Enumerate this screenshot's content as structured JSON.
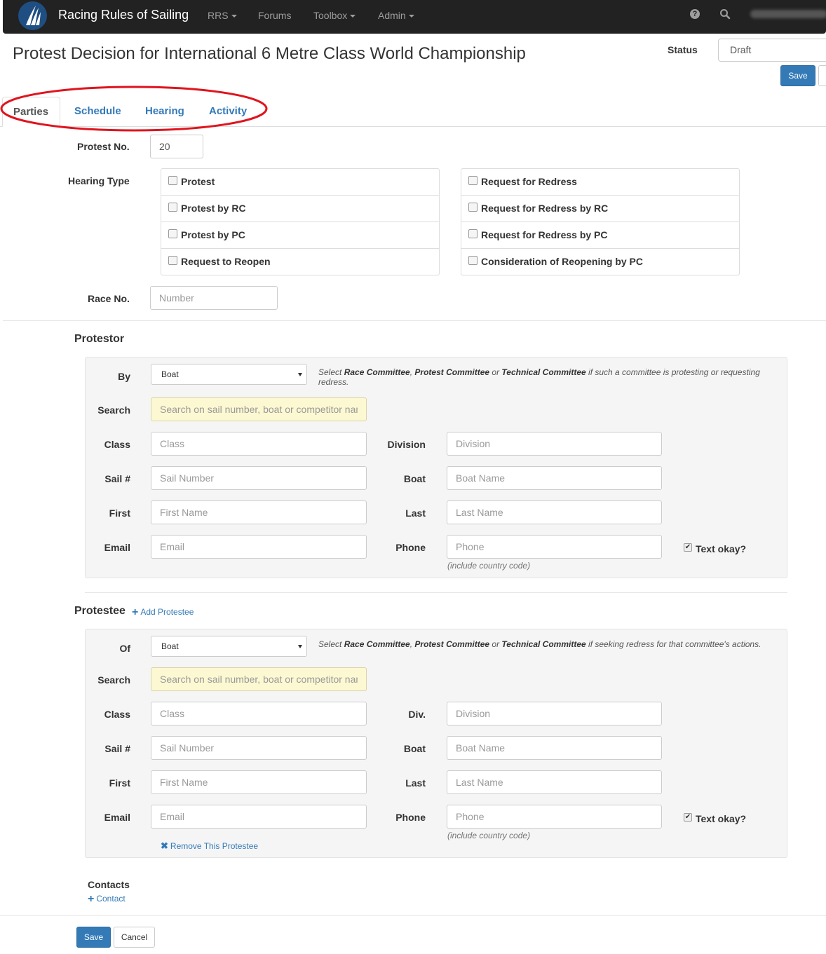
{
  "navbar": {
    "brand": "Racing Rules of Sailing",
    "menu": [
      "RRS",
      "Forums",
      "Toolbox",
      "Admin"
    ],
    "help_icon": "question-circle-icon",
    "search_icon": "search-icon"
  },
  "header": {
    "title": "Protest Decision for International 6 Metre Class World Championship",
    "status_label": "Status",
    "status_value": "Draft",
    "save_label": "Save"
  },
  "tabs": [
    "Parties",
    "Schedule",
    "Hearing",
    "Activity"
  ],
  "form": {
    "protest_no_label": "Protest No.",
    "protest_no_value": "20",
    "hearing_type_label": "Hearing Type",
    "hearing_types_left": [
      "Protest",
      "Protest by RC",
      "Protest by PC",
      "Request to Reopen"
    ],
    "hearing_types_right": [
      "Request for Redress",
      "Request for Redress by RC",
      "Request for Redress by PC",
      "Consideration of Reopening by PC"
    ],
    "race_no_label": "Race No.",
    "race_no_placeholder": "Number"
  },
  "protestor": {
    "title": "Protestor",
    "by_label": "By",
    "by_value": "Boat",
    "hint_pre": "Select ",
    "hint_rc": "Race Committee",
    "hint_sep1": ", ",
    "hint_pc": "Protest Committee",
    "hint_or": " or ",
    "hint_tc": "Technical Committee",
    "hint_post": " if such a committee is protesting or requesting redress.",
    "search_label": "Search",
    "search_placeholder": "Search on sail number, boat or competitor name",
    "class_label": "Class",
    "class_placeholder": "Class",
    "division_label": "Division",
    "division_placeholder": "Division",
    "sail_label": "Sail #",
    "sail_placeholder": "Sail Number",
    "boat_label": "Boat",
    "boat_placeholder": "Boat Name",
    "first_label": "First",
    "first_placeholder": "First Name",
    "last_label": "Last",
    "last_placeholder": "Last Name",
    "email_label": "Email",
    "email_placeholder": "Email",
    "phone_label": "Phone",
    "phone_placeholder": "Phone",
    "phone_help": "(include country code)",
    "text_okay_label": "Text okay?",
    "text_okay_checked": true
  },
  "protestee": {
    "title": "Protestee",
    "add_label": "Add Protestee",
    "of_label": "Of",
    "of_value": "Boat",
    "hint_pre": "Select ",
    "hint_rc": "Race Committee",
    "hint_sep1": ", ",
    "hint_pc": "Protest Committee",
    "hint_or": " or ",
    "hint_tc": "Technical Committee",
    "hint_post": " if seeking redress for that committee's actions.",
    "search_label": "Search",
    "search_placeholder": "Search on sail number, boat or competitor name",
    "class_label": "Class",
    "class_placeholder": "Class",
    "division_label": "Div.",
    "division_placeholder": "Division",
    "sail_label": "Sail #",
    "sail_placeholder": "Sail Number",
    "boat_label": "Boat",
    "boat_placeholder": "Boat Name",
    "first_label": "First",
    "first_placeholder": "First Name",
    "last_label": "Last",
    "last_placeholder": "Last Name",
    "email_label": "Email",
    "email_placeholder": "Email",
    "phone_label": "Phone",
    "phone_placeholder": "Phone",
    "phone_help": "(include country code)",
    "text_okay_label": "Text okay?",
    "text_okay_checked": true,
    "remove_label": "Remove This Protestee"
  },
  "contacts": {
    "title": "Contacts",
    "add_label": "Contact"
  },
  "footer": {
    "save_label": "Save",
    "cancel_label": "Cancel"
  },
  "colors": {
    "navbar": "#222222",
    "link": "#337ab7",
    "primary": "#337ab7",
    "search_bg": "#fcf8d2",
    "annotation_oval": "#e0141e"
  }
}
